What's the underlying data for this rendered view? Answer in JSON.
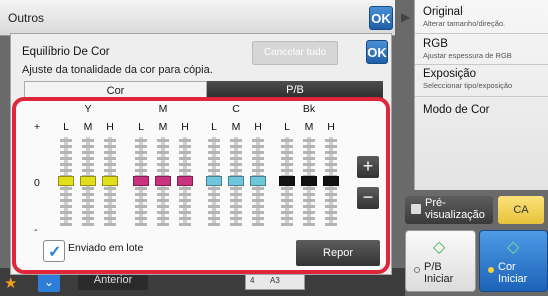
{
  "background": {
    "title": "Outros",
    "ok_label": "OK",
    "previous_label": "Anterior",
    "status": {
      "count": "4",
      "paper": "A3"
    }
  },
  "right_panel": {
    "items": [
      {
        "title": "Original",
        "subtitle": "Alterar tamanho/direção."
      },
      {
        "title": "RGB",
        "subtitle": "Ajustar espessura de RGB"
      },
      {
        "title": "Exposição",
        "subtitle": "Seleccionar tipo/exposição"
      },
      {
        "title": "Modo de Cor",
        "subtitle": ""
      }
    ],
    "preview_label": "Pré-visualização",
    "ca_label": "CA",
    "start_pb": "P/B\nIniciar",
    "start_color": "Cor\nIniciar"
  },
  "dialog": {
    "title": "Equilíbrio De Cor",
    "subtitle": "Ajuste da tonalidade da cor para cópia.",
    "ok_label": "OK",
    "cancel_label": "Cancelar tudo",
    "tabs": [
      "Cor",
      "P/B"
    ],
    "active_tab": "Cor",
    "scale": {
      "plus": "+",
      "zero": "0",
      "minus": "-"
    },
    "groups": [
      {
        "name": "Y",
        "color": "#e2de1c",
        "columns": [
          "L",
          "M",
          "H"
        ],
        "values": [
          0,
          0,
          0
        ]
      },
      {
        "name": "M",
        "color": "#c8327e",
        "columns": [
          "L",
          "M",
          "H"
        ],
        "values": [
          0,
          0,
          0
        ]
      },
      {
        "name": "C",
        "color": "#6ec6dc",
        "columns": [
          "L",
          "M",
          "H"
        ],
        "values": [
          0,
          0,
          0
        ]
      },
      {
        "name": "Bk",
        "color": "#111111",
        "columns": [
          "L",
          "M",
          "H"
        ],
        "values": [
          0,
          0,
          0
        ]
      }
    ],
    "plus_button": "+",
    "minus_button": "−",
    "batch_label": "Enviado em lote",
    "batch_checked": true,
    "reset_label": "Repor"
  }
}
